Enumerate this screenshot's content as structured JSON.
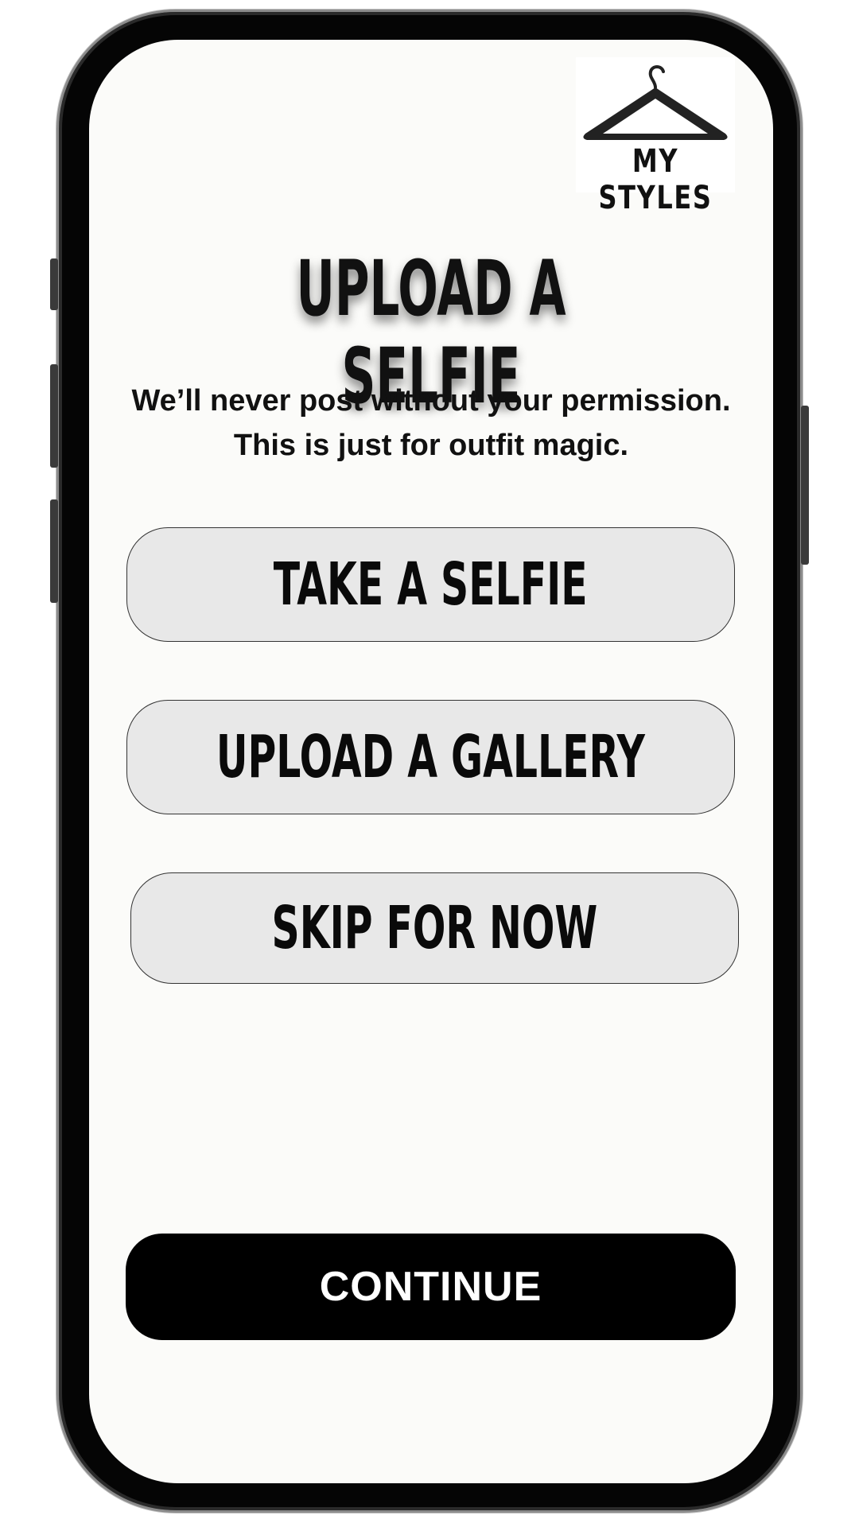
{
  "brand": {
    "name": "MY STYLES",
    "logo_icon": "hanger-icon"
  },
  "title": "UPLOAD A SELFIE",
  "subtitle": {
    "line1": "We’ll never post without your permission.",
    "line2": "This is just for outfit magic."
  },
  "options": {
    "take_selfie": "TAKE A SELFIE",
    "upload_gallery": "UPLOAD A GALLERY",
    "skip": "SKIP FOR NOW"
  },
  "continue_label": "CONTINUE",
  "colors": {
    "button_fill": "#e8e8e8",
    "primary": "#000000",
    "background": "#fbfbf9"
  }
}
